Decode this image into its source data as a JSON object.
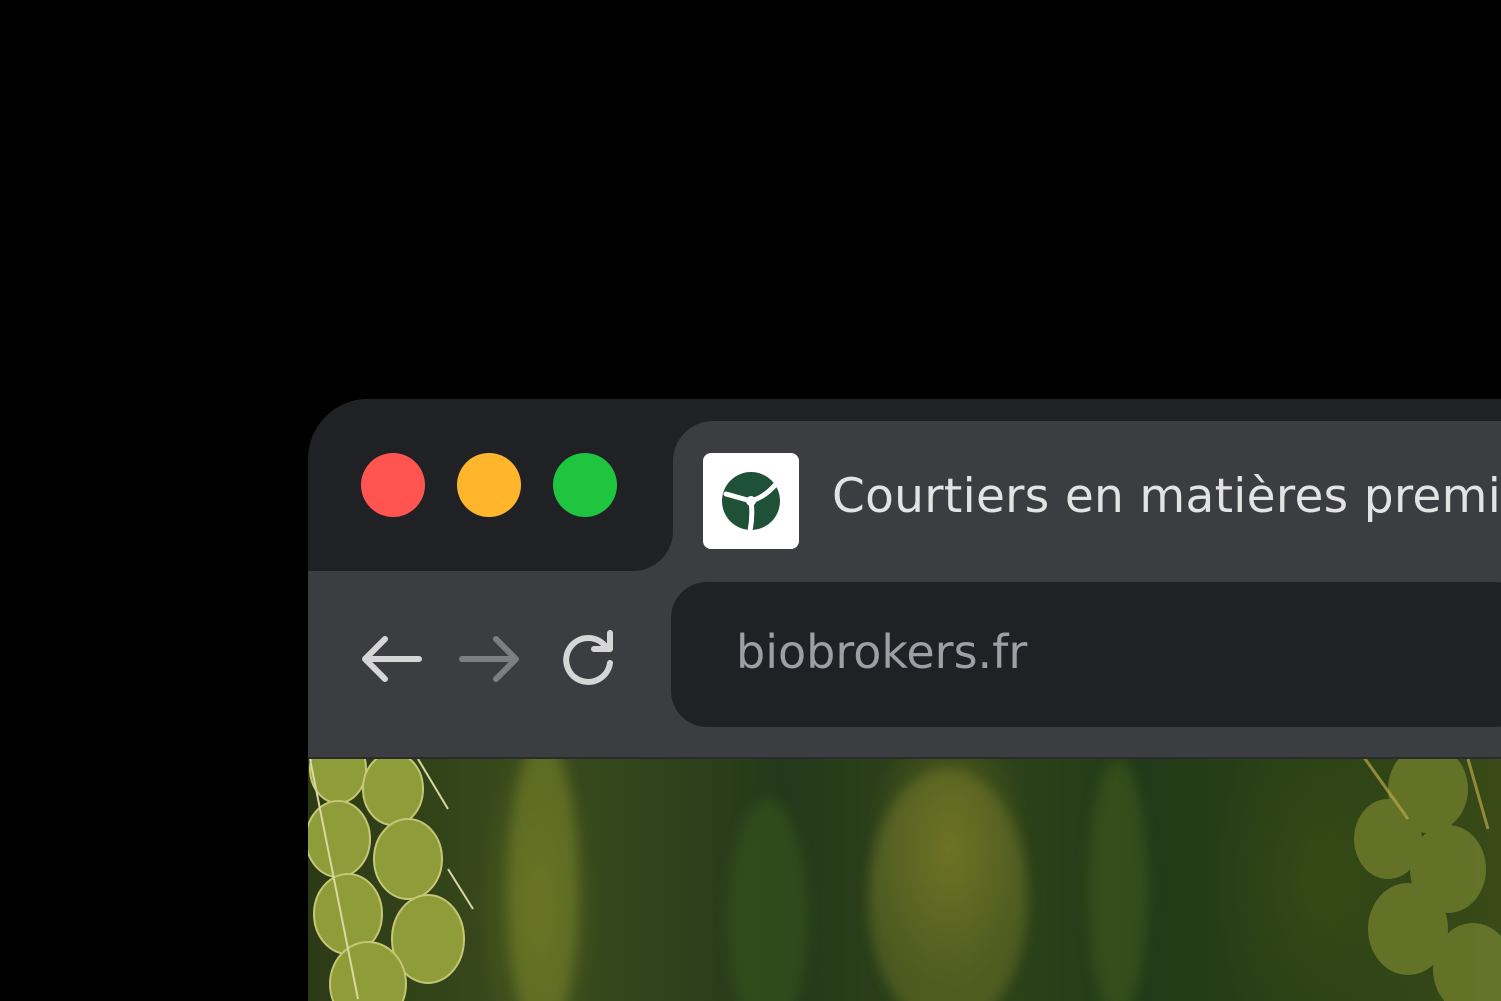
{
  "window": {
    "traffic_lights": [
      {
        "name": "close",
        "color": "#ff5450"
      },
      {
        "name": "minimize",
        "color": "#ffb62d"
      },
      {
        "name": "zoom",
        "color": "#1fc43f"
      }
    ]
  },
  "tab": {
    "title": "Courtiers en matières premiè",
    "favicon": "biobrokers-logo-icon",
    "favicon_color": "#1f5038"
  },
  "toolbar": {
    "back_icon": "arrow-left-icon",
    "forward_icon": "arrow-right-icon",
    "reload_icon": "reload-icon",
    "address": "biobrokers.fr"
  },
  "colors": {
    "background": "#000000",
    "titlebar": "#202124",
    "tab_active": "#3c3d40",
    "omnibox": "#202124",
    "text_primary": "#e3e3e3",
    "text_secondary": "#9aa0a6"
  },
  "page_content": {
    "image": "wheat-field-photo"
  }
}
